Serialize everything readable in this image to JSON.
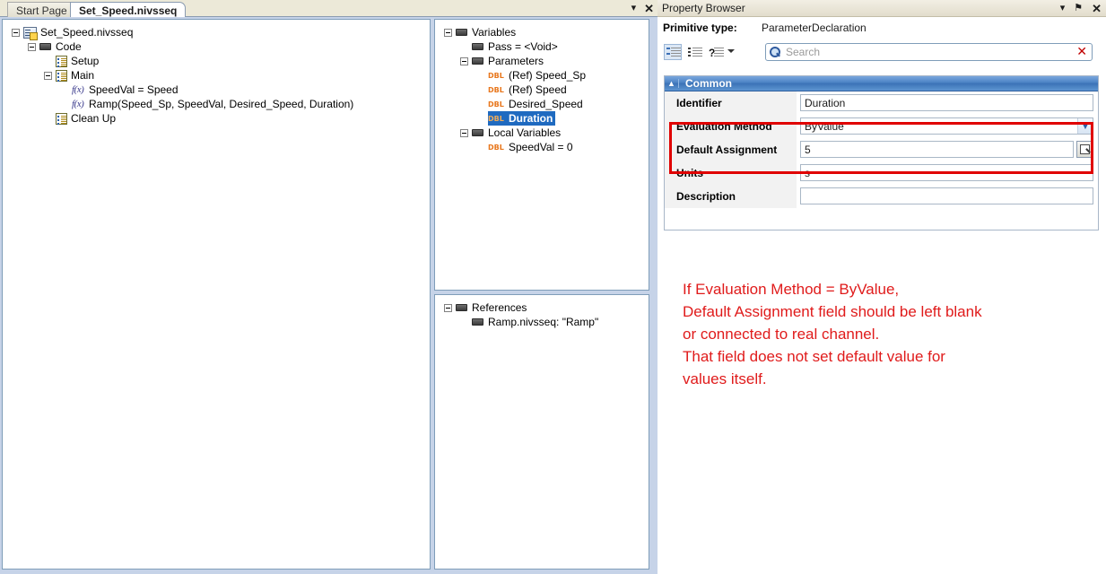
{
  "tabs": [
    {
      "label": "Start Page",
      "active": false
    },
    {
      "label": "Set_Speed.nivsseq",
      "active": true
    }
  ],
  "tab_controls": {
    "dropdown": "▾",
    "close": "✕"
  },
  "sequence_tree": [
    {
      "indent": 0,
      "expander": "expanded",
      "icon": "sequence-file-icon",
      "label": "Set_Speed.nivsseq"
    },
    {
      "indent": 1,
      "expander": "expanded",
      "icon": "block-icon",
      "label": "Code"
    },
    {
      "indent": 2,
      "expander": "none",
      "icon": "step-icon",
      "label": "Setup"
    },
    {
      "indent": 2,
      "expander": "expanded",
      "icon": "step-icon",
      "label": "Main"
    },
    {
      "indent": 3,
      "expander": "none",
      "icon": "function-icon",
      "label": "SpeedVal = Speed"
    },
    {
      "indent": 3,
      "expander": "none",
      "icon": "function-icon",
      "label": "Ramp(Speed_Sp, SpeedVal, Desired_Speed, Duration)"
    },
    {
      "indent": 2,
      "expander": "none",
      "icon": "step-icon",
      "label": "Clean Up"
    }
  ],
  "variables_tree": [
    {
      "indent": 0,
      "expander": "expanded",
      "icon": "block-icon",
      "label": "Variables",
      "selected": false
    },
    {
      "indent": 1,
      "expander": "none",
      "icon": "block-icon",
      "label": "Pass = <Void>",
      "selected": false
    },
    {
      "indent": 1,
      "expander": "expanded",
      "icon": "block-icon",
      "label": "Parameters",
      "selected": false
    },
    {
      "indent": 2,
      "expander": "none",
      "icon": "dbl-type-icon",
      "label": "(Ref) Speed_Sp",
      "selected": false
    },
    {
      "indent": 2,
      "expander": "none",
      "icon": "dbl-type-icon",
      "label": "(Ref) Speed",
      "selected": false
    },
    {
      "indent": 2,
      "expander": "none",
      "icon": "dbl-type-icon",
      "label": "Desired_Speed",
      "selected": false
    },
    {
      "indent": 2,
      "expander": "none",
      "icon": "dbl-type-icon",
      "label": "Duration",
      "selected": true
    },
    {
      "indent": 1,
      "expander": "expanded",
      "icon": "block-icon",
      "label": "Local Variables",
      "selected": false
    },
    {
      "indent": 2,
      "expander": "none",
      "icon": "dbl-type-icon",
      "label": "SpeedVal = 0",
      "selected": false
    }
  ],
  "references_tree": [
    {
      "indent": 0,
      "expander": "expanded",
      "icon": "block-icon",
      "label": "References",
      "selected": false
    },
    {
      "indent": 1,
      "expander": "none",
      "icon": "block-icon",
      "label": "Ramp.nivsseq: \"Ramp\"",
      "selected": false
    }
  ],
  "property_browser": {
    "title": "Property Browser",
    "window_controls": {
      "dropdown": "▾",
      "pin": "⚑",
      "close": "✕"
    },
    "primitive_type_label": "Primitive type:",
    "primitive_type_value": "ParameterDeclaration",
    "toolbar": {
      "categorized_label": "categorized-view-icon",
      "alphabetical_label": "alphabetical-view-icon",
      "help_label": "?",
      "help_dropdown": "▾"
    },
    "search": {
      "placeholder": "Search",
      "value": "",
      "clear_label": "✕"
    },
    "grid": {
      "group_header": "Common",
      "group_collapse_glyph": "▲",
      "rows": [
        {
          "name": "Identifier",
          "value": "Duration",
          "editor": "text"
        },
        {
          "name": "Evaluation Method",
          "value": "ByValue",
          "editor": "combo"
        },
        {
          "name": "Default Assignment",
          "value": "5",
          "editor": "text-browse"
        },
        {
          "name": "Units",
          "value": "s",
          "editor": "text"
        },
        {
          "name": "Description",
          "value": "",
          "editor": "text"
        }
      ]
    }
  },
  "annotation": {
    "color": "#e01b1b",
    "lines": [
      "If Evaluation Method = ByValue,",
      "Default Assignment field should be left blank",
      "or connected to real channel.",
      "That field does not set default value for",
      "values itself."
    ]
  }
}
